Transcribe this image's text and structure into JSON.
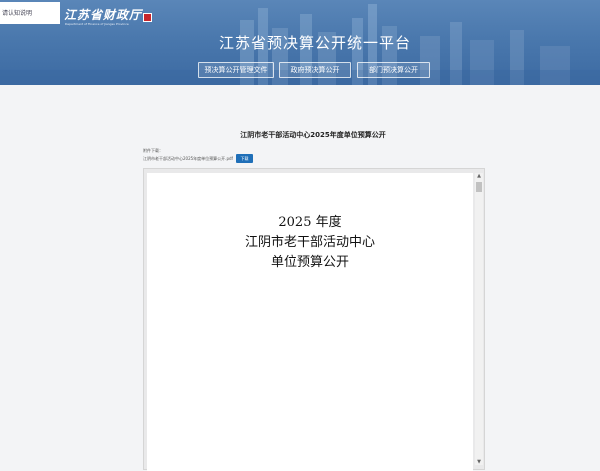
{
  "header": {
    "left_box_text": "请认知说明",
    "logo_text": "江苏省财政厅",
    "logo_subtext": "Department of Finance of Jiangsu Province",
    "site_title": "江苏省预决算公开统一平台",
    "nav": [
      {
        "label": "预决算公开管理文件"
      },
      {
        "label": "政府预决算公开"
      },
      {
        "label": "部门预决算公开"
      }
    ]
  },
  "document": {
    "title": "江阴市老干部活动中心2025年度单位预算公开",
    "attachment_label": "附件下载：",
    "attachment_filename": "江阴市老干部活动中心2025年度单位预算公开.pdf",
    "download_label": "下载"
  },
  "pdf_page": {
    "lines": [
      "2025 年度",
      "江阴市老干部活动中心",
      "单位预算公开"
    ]
  },
  "colors": {
    "banner": "#4a78ad",
    "button": "#1f6fb8",
    "background": "#f3f4f6"
  }
}
